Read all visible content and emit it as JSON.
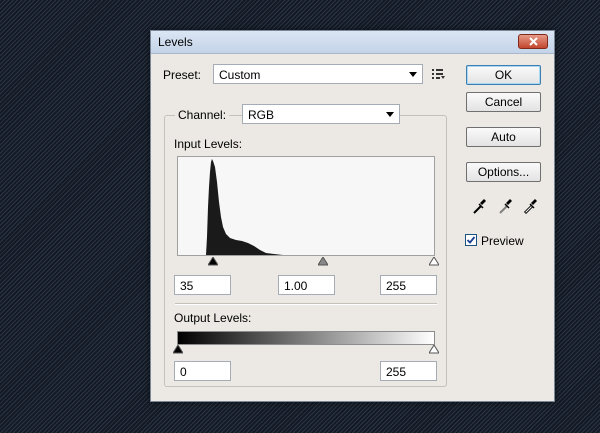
{
  "window": {
    "title": "Levels"
  },
  "preset": {
    "label": "Preset:",
    "value": "Custom"
  },
  "channel": {
    "label": "Channel:",
    "value": "RGB"
  },
  "input_levels": {
    "label": "Input Levels:",
    "black": "35",
    "gamma": "1.00",
    "white": "255"
  },
  "output_levels": {
    "label": "Output Levels:",
    "black": "0",
    "white": "255"
  },
  "buttons": {
    "ok": "OK",
    "cancel": "Cancel",
    "auto": "Auto",
    "options": "Options..."
  },
  "preview": {
    "label": "Preview",
    "checked": true
  },
  "icons": {
    "close": "close-icon",
    "preset_menu": "preset-options-icon",
    "eyedroppers": [
      "black-eyedropper-icon",
      "gray-eyedropper-icon",
      "white-eyedropper-icon"
    ]
  },
  "colors": {
    "close_button": "#c2472e",
    "titlebar": "#c3d3e8",
    "accent_border": "#3c7fb1"
  }
}
